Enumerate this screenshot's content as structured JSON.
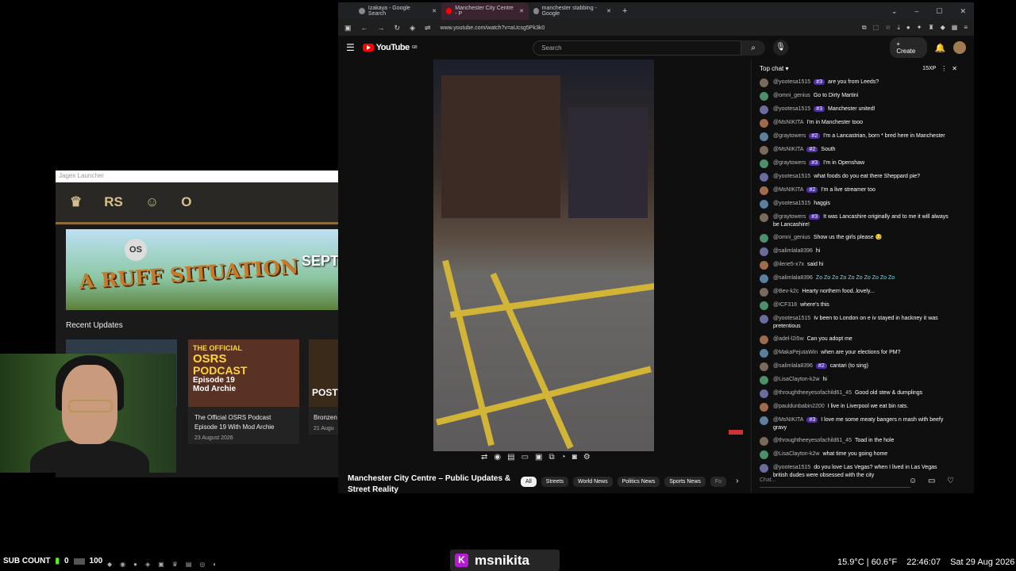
{
  "launcher": {
    "title": "Jagex Launcher",
    "games": [
      "RS",
      "O"
    ],
    "banner": {
      "title": "A RUFF SITUATION",
      "badge": "OS",
      "side": "SEPT"
    },
    "recent_title": "Recent Updates",
    "cards": [
      {
        "title": "",
        "date": ""
      },
      {
        "title": "The Official OSRS Podcast Episode 19 With Mod Archie",
        "date": "23 August 2026"
      },
      {
        "title": "Bronzen",
        "date": "21 Augu"
      }
    ],
    "podcast_art": {
      "line1": "THE OFFICIAL",
      "line2": "OSRS",
      "line3": "PODCAST",
      "line4": "Episode 19",
      "line5": "Mod Archie"
    },
    "post_art": "POST"
  },
  "browser": {
    "tabs": [
      {
        "label": "Izakaya - Google Search"
      },
      {
        "label": "Manchester City Centre - P"
      },
      {
        "label": "manchester stabbing - Google"
      }
    ],
    "url": "www.youtube.com/watch?v=aUcsg5Pk3k0",
    "youtube": {
      "logo": "YouTube",
      "logo_region": "GB",
      "search_placeholder": "Search",
      "create_label": "Create",
      "video_title": "Manchester City Centre – Public Updates & Street Reality",
      "chips": [
        "All",
        "Streets",
        "World News",
        "Politics News",
        "Sports News",
        "Fo"
      ]
    }
  },
  "chat": {
    "header": "Top chat",
    "xp": "15XP",
    "input_placeholder": "Chat...",
    "messages": [
      {
        "author": "@yootesa1515",
        "badge": "#3",
        "text": "are you from Leeds?"
      },
      {
        "author": "@omni_genius",
        "badge": "",
        "text": "Go to Dirty Martini"
      },
      {
        "author": "@yootesa1515",
        "badge": "#3",
        "text": "Manchester united!"
      },
      {
        "author": "@MsNIKITA",
        "badge": "",
        "text": "I'm in Manchester tooo"
      },
      {
        "author": "@graytowers",
        "badge": "#2",
        "text": "I'm a Lancastrian, born * bred here in Manchester"
      },
      {
        "author": "@MsNIKITA",
        "badge": "#2",
        "text": "South"
      },
      {
        "author": "@graytowers",
        "badge": "#3",
        "text": "I'm in Openshaw"
      },
      {
        "author": "@yootesa1515",
        "badge": "",
        "text": "what foods do you eat there Sheppard pie?"
      },
      {
        "author": "@MsNIKITA",
        "badge": "#2",
        "text": "I'm a live streamer too"
      },
      {
        "author": "@yootesa1515",
        "badge": "",
        "text": "haggis"
      },
      {
        "author": "@graytowers",
        "badge": "#3",
        "text": "It was Lancashire originally and to me it will always be Lancashire!"
      },
      {
        "author": "@omni_genius",
        "badge": "",
        "text": "Show us the girls please 😏"
      },
      {
        "author": "@salimlala8396",
        "badge": "",
        "text": "hi"
      },
      {
        "author": "@ilene5-x7x",
        "badge": "",
        "text": "said hi"
      },
      {
        "author": "@salimlala8396",
        "badge": "",
        "text": "Zo Zo Zo Zo Zo Zo Zo Zo Zo Zo"
      },
      {
        "author": "@Bev-k2c",
        "badge": "",
        "text": "Hearty northern food..lovely..."
      },
      {
        "author": "@ICF318",
        "badge": "",
        "text": "where's this"
      },
      {
        "author": "@yootesa1515",
        "badge": "",
        "text": "Iv been to London on e iv stayed in hackney it was pretentious"
      },
      {
        "author": "@adel-l2i5w",
        "badge": "",
        "text": "Can you adopt me"
      },
      {
        "author": "@MakaPejutaWin",
        "badge": "",
        "text": "when are your elections for PM?"
      },
      {
        "author": "@salimlala8396",
        "badge": "#2",
        "text": "cantari (to sing)"
      },
      {
        "author": "@LisaClayton-k2w",
        "badge": "",
        "text": "hi"
      },
      {
        "author": "@throughtheeyesofachild61_45",
        "badge": "",
        "text": "Good old stew & dumplings"
      },
      {
        "author": "@pauldunbabin2200",
        "badge": "",
        "text": "I live in Liverpool we eat bin rats."
      },
      {
        "author": "@MsNIKITA",
        "badge": "#3",
        "text": "I love me some meaty bangers n mash with beefy gravy"
      },
      {
        "author": "@throughtheeyesofachild61_45",
        "badge": "",
        "text": "Toad in the hole"
      },
      {
        "author": "@LisaClayton-k2w",
        "badge": "",
        "text": "what time you going home"
      },
      {
        "author": "@yootesa1515",
        "badge": "",
        "text": "do you love Las Vegas? when I lived in Las Vegas british dudes were obsessed with the city"
      }
    ]
  },
  "overlay": {
    "sub_label": "SUB COUNT",
    "sub_current": "0",
    "sub_goal": "100",
    "streamer": "msnikita",
    "kick_letter": "K",
    "weather": "15.9°C | 60.6°F",
    "time": "22:46:07",
    "date": "Sat 29 Aug 2026"
  }
}
